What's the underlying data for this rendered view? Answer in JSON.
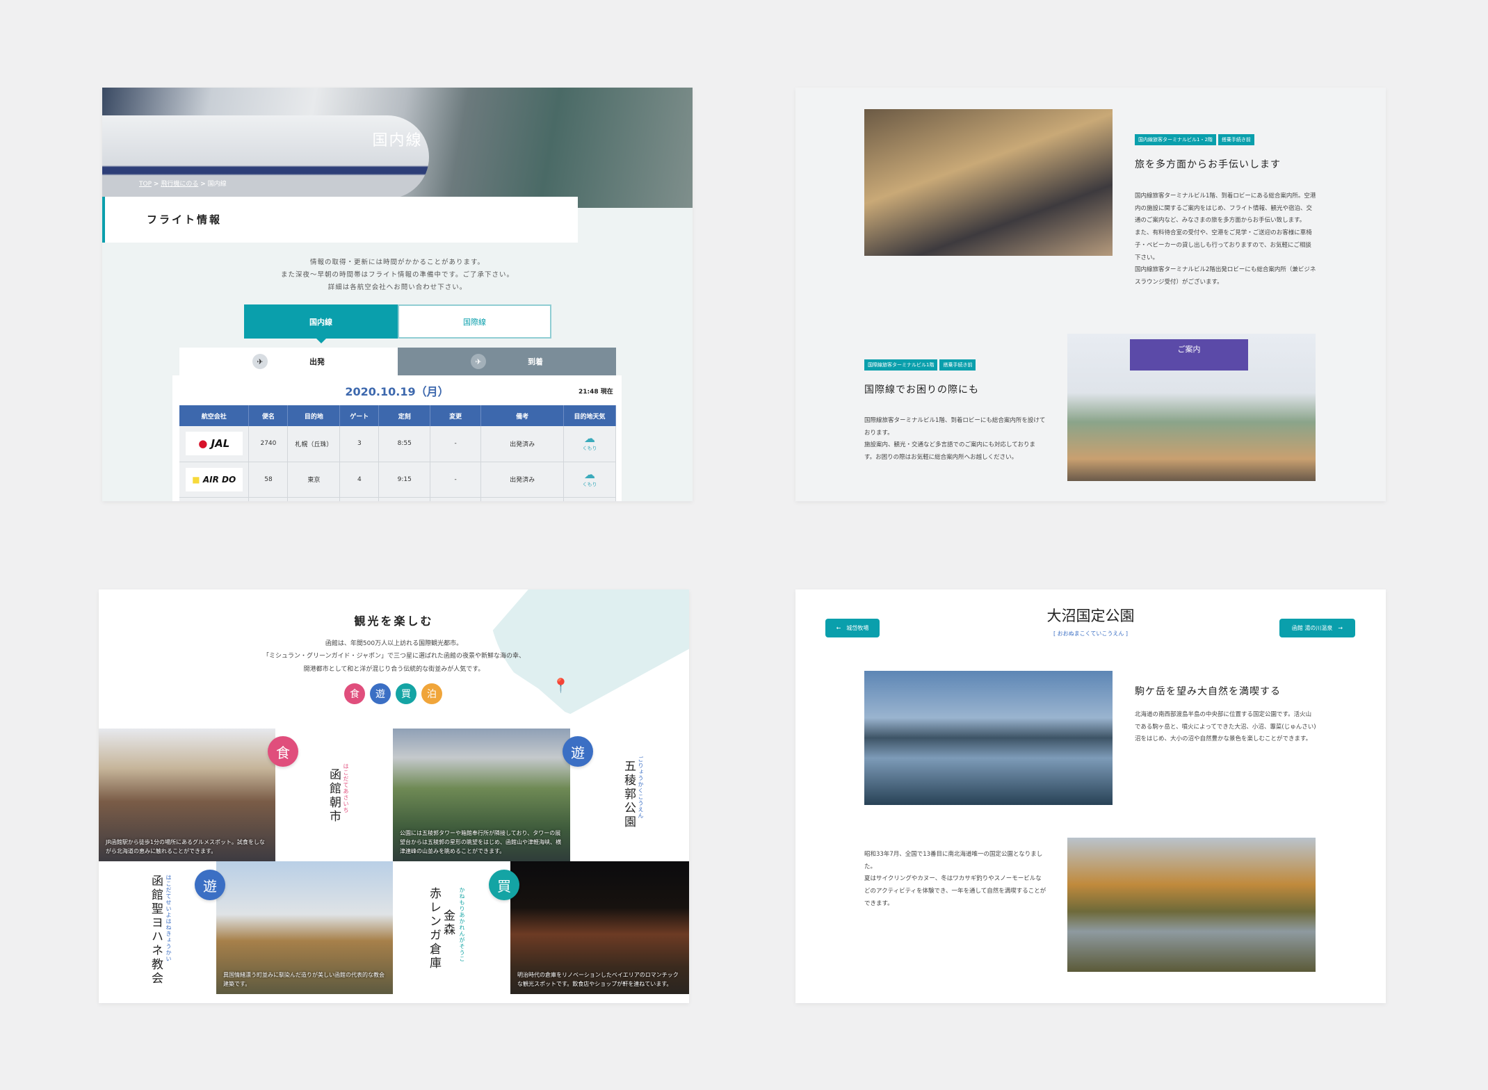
{
  "flight": {
    "hero_title": "国内線",
    "breadcrumb": [
      "TOP",
      "飛行機にのる",
      "国内線"
    ],
    "breadcrumb_sep": ">",
    "section_title": "フライト情報",
    "notice": [
      "情報の取得・更新には時間がかかることがあります。",
      "また深夜～早朝の時間帯はフライト情報の準備中です。ご了承下さい。",
      "詳細は各航空会社へお問い合わせ下さい。"
    ],
    "tabs": [
      {
        "label": "国内線",
        "active": true
      },
      {
        "label": "国際線",
        "active": false
      }
    ],
    "subtabs": [
      {
        "label": "出発",
        "icon": "departure-icon",
        "active": true
      },
      {
        "label": "到着",
        "icon": "arrival-icon",
        "active": false
      }
    ],
    "date": "2020.10.19（月）",
    "time": "21:48 現在",
    "columns": [
      "航空会社",
      "便名",
      "目的地",
      "ゲート",
      "定刻",
      "変更",
      "備考",
      "目的地天気"
    ],
    "rows": [
      {
        "airline": "JAL",
        "flight": "2740",
        "dest": "札幌（丘珠）",
        "gate": "3",
        "sched": "8:55",
        "change": "-",
        "note": "出発済み",
        "weather": "くもり"
      },
      {
        "airline": "AIR DO",
        "flight": "58",
        "dest": "東京",
        "gate": "4",
        "sched": "9:15",
        "change": "-",
        "note": "出発済み",
        "weather": "くもり"
      }
    ]
  },
  "info": {
    "s1": {
      "tags": [
        "国内線旅客ターミナルビル1・2階",
        "搭乗手続き前"
      ],
      "title": "旅を多方面からお手伝いします",
      "text": "国内線旅客ターミナルビル1階、到着ロビーにある総合案内所。空港内の施設に関するご案内をはじめ、フライト情報、観光や宿泊、交通のご案内など、みなさまの旅を多方面からお手伝い致します。\nまた、有料待合室の受付や、空港をご見学・ご送迎のお客様に車椅子・ベビーカーの貸し出しも行っておりますので、お気軽にご相談下さい。\n国内線旅客ターミナルビル2階出発ロビーにも総合案内所（兼ビジネスラウンジ受付）がございます。"
    },
    "s2": {
      "tags": [
        "国際線旅客ターミナルビル1階",
        "搭乗手続き前"
      ],
      "title": "国際線でお困りの際にも",
      "text": "国際線旅客ターミナルビル1階、到着ロビーにも総合案内所を設けております。\n施設案内、観光・交通など多言語でのご案内にも対応しております。お困りの際はお気軽に総合案内所へお越しください。"
    },
    "sign": "ご案内"
  },
  "tourism": {
    "title": "観光を楽しむ",
    "intro": [
      "函館は、年間500万人以上訪れる国際観光都市。",
      "「ミシュラン・グリーンガイド・ジャポン」で三つ星に選ばれた函館の夜景や新鮮な海の幸、",
      "開港都市として和と洋が混じり合う伝統的な街並みが人気です。"
    ],
    "categories": [
      {
        "label": "食",
        "color": "#e04e7c"
      },
      {
        "label": "遊",
        "color": "#3b6fc4"
      },
      {
        "label": "買",
        "color": "#14a4a4"
      },
      {
        "label": "泊",
        "color": "#f0a53a"
      }
    ],
    "spots": [
      {
        "name": "函館朝市",
        "ruby": "はこだてあさいち",
        "badge": "食",
        "caption": "JR函館駅から徒歩1分の場所にあるグルメスポット。試食をしながら北海道の恵みに触れることができます。"
      },
      {
        "name": "五稜郭公園",
        "ruby": "ごりょうかくこうえん",
        "badge": "遊",
        "caption": "公園には五稜郭タワーや箱館奉行所が隣接しており、タワーの展望台からは五稜郭の星形の眺望をはじめ、函館山や津軽海峡、横津連峰の山並みを眺めることができます。"
      },
      {
        "name": "函館聖ヨハネ教会",
        "ruby": "はこだてせいよはねきょうかい",
        "badge": "遊",
        "caption": "異国情緒漂う町並みに馴染んだ造りが美しい函館の代表的な教会建築です。"
      },
      {
        "name_a": "金森",
        "name_b": "赤レンガ倉庫",
        "ruby": "かねもりあかれんがそうこ",
        "badge": "買",
        "caption": "明治時代の倉庫をリノベーションしたベイエリアのロマンチックな観光スポットです。飲食店やショップが軒を連ねています。"
      }
    ]
  },
  "park": {
    "title": "大沼国定公園",
    "ruby": "おおぬまこくていこうえん",
    "prev": "城岱牧場",
    "next": "函館 湯の川温泉",
    "heading": "駒ケ岳を望み大自然を満喫する",
    "text1": "北海道の南西部渡島半島の中央部に位置する国定公園です。活火山である駒ヶ岳と、噴火によってできた大沼、小沼、蓴菜(じゅんさい)沼をはじめ、大小の沼や自然豊かな景色を楽しむことができます。",
    "text2": "昭和33年7月、全国で13番目に南北海道唯一の国定公園となりました。\n夏はサイクリングやカヌー、冬はワカサギ釣りやスノーモービルなどのアクティビティを体験でき、一年を通して自然を満喫することができます。"
  },
  "colors": {
    "accent": "#0a9fac",
    "table_header": "#3d68ad"
  }
}
